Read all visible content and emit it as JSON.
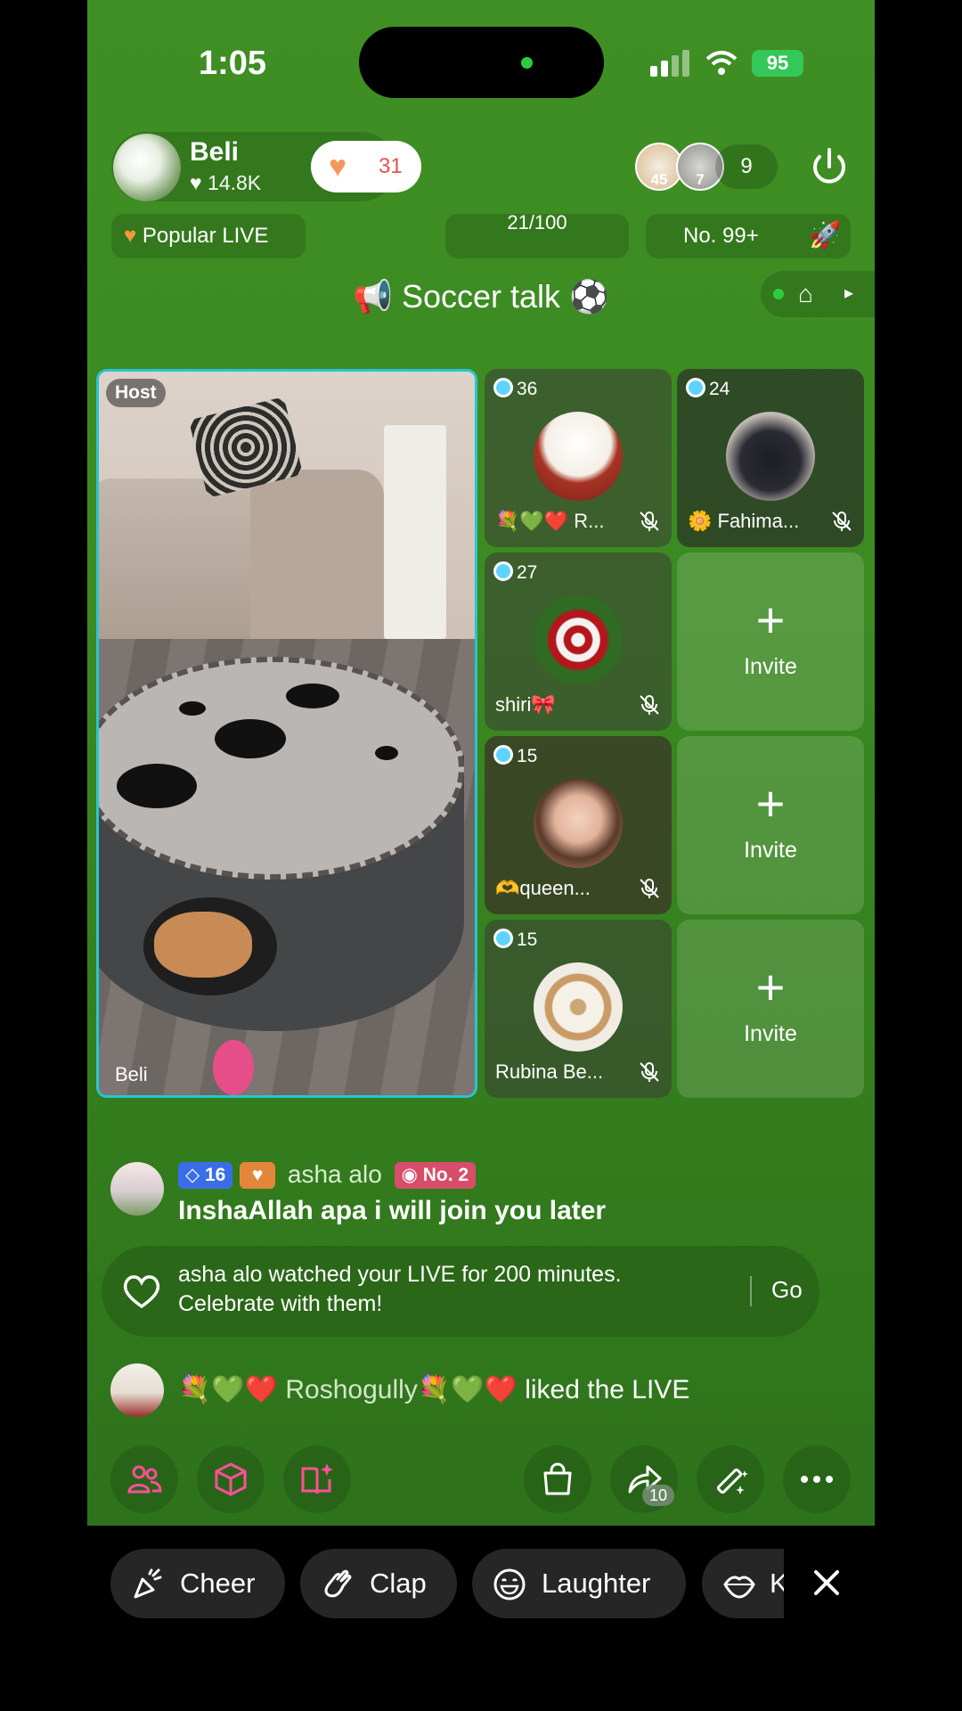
{
  "status_bar": {
    "time": "1:05",
    "battery": "95"
  },
  "header": {
    "host_name": "Beli",
    "host_likes": "♥ 14.8K",
    "like_count": "31",
    "viewer_badges": [
      "45",
      "7"
    ],
    "viewer_count": "9"
  },
  "pills": {
    "popular": "Popular LIVE",
    "progress": "21/100",
    "rank": "No. 99+"
  },
  "topic": "📢 Soccer talk ⚽",
  "host_tile": {
    "tag": "Host",
    "name": "Beli"
  },
  "guests": [
    {
      "level": "36",
      "name": "💐💚❤️ R..."
    },
    {
      "level": "24",
      "name": "🌼 Fahima..."
    },
    {
      "level": "27",
      "name": "shiri🎀"
    },
    {
      "level": "15",
      "name": "🫶queen..."
    },
    {
      "level": "15",
      "name": "Rubina Be..."
    }
  ],
  "invite": {
    "plus": "+",
    "label": "Invite"
  },
  "chat": {
    "msg1": {
      "level": "16",
      "user": "asha alo",
      "rank": "No. 2",
      "text": "InshaAllah apa i will join you later"
    },
    "notice": {
      "text": "asha alo watched your LIVE for 200 minutes. Celebrate with them!",
      "action": "Go"
    },
    "msg2": {
      "user": "💐💚❤️ Roshogully💐💚❤️",
      "text": " liked the LIVE"
    }
  },
  "toolbar": {
    "share_count": "10"
  },
  "reactions": [
    "Cheer",
    "Clap",
    "Laughter",
    "K"
  ],
  "colors": {
    "background": "#3b8a22",
    "host_border": "#29c5d0",
    "like_heart": "#f4975f"
  }
}
